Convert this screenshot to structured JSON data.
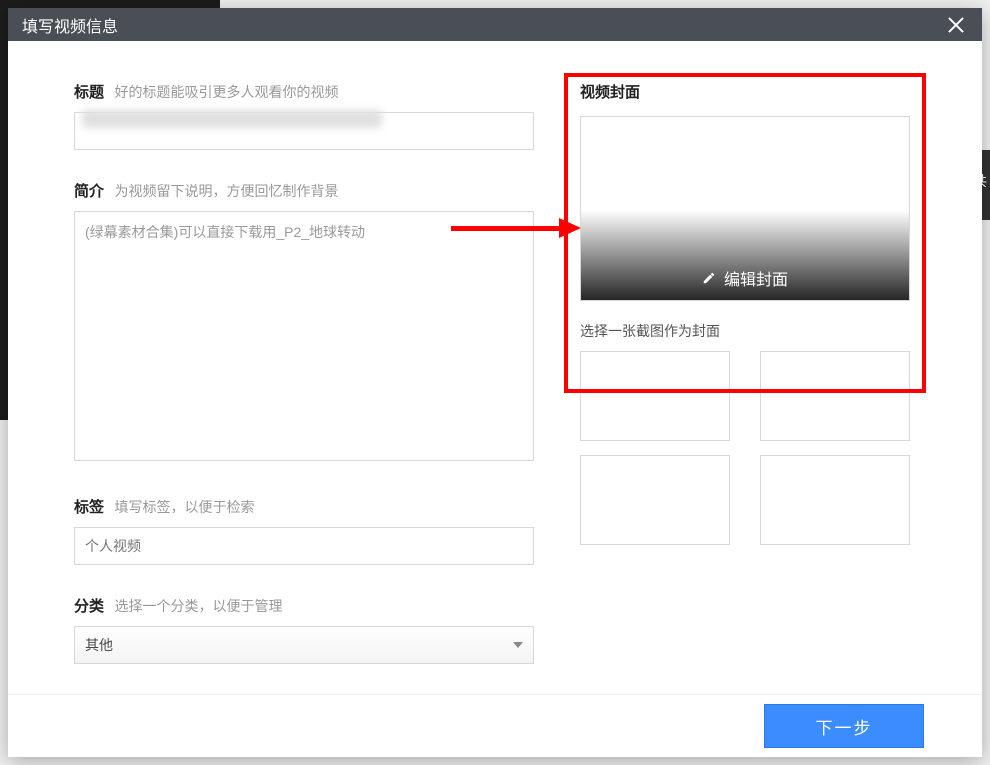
{
  "dialog": {
    "title": "填写视频信息"
  },
  "form": {
    "titleField": {
      "label": "标题",
      "hint": "好的标题能吸引更多人观看你的视频",
      "value": ""
    },
    "descField": {
      "label": "简介",
      "hint": "为视频留下说明，方便回忆制作背景",
      "value": "(绿幕素材合集)可以直接下载用_P2_地球转动"
    },
    "tagField": {
      "label": "标签",
      "hint": "填写标签，以便于检索",
      "placeholder": "个人视频"
    },
    "categoryField": {
      "label": "分类",
      "hint": "选择一个分类，以便于管理",
      "selected": "其他"
    }
  },
  "cover": {
    "title": "视频封面",
    "editLabel": "编辑封面",
    "thumbHint": "选择一张截图作为封面"
  },
  "footer": {
    "nextLabel": "下一步"
  },
  "bgSide": {
    "char1": "共"
  }
}
